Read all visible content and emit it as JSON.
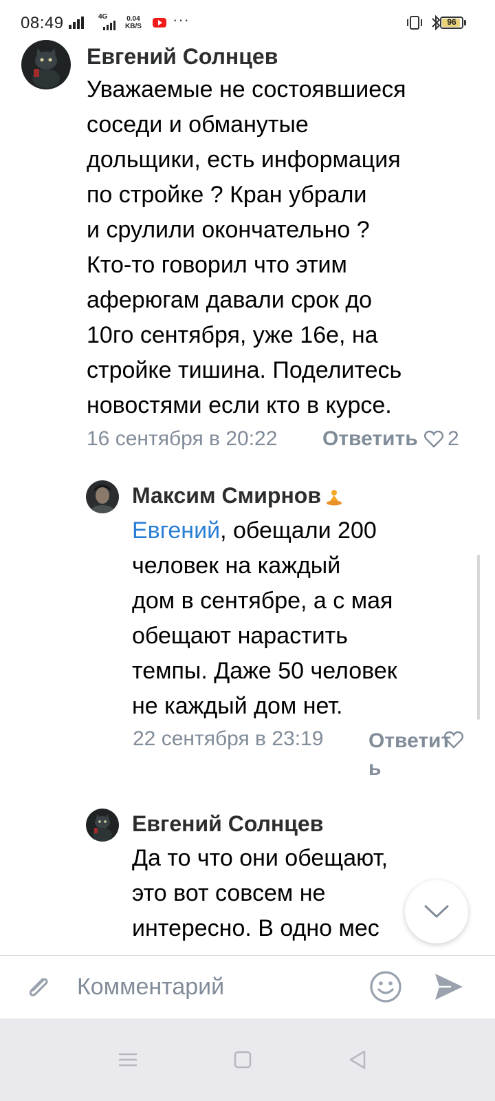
{
  "status_bar": {
    "time": "08:49",
    "network": "4G",
    "speed_value": "0.04",
    "speed_unit": "KB/S",
    "more": "···",
    "battery": "96",
    "icons": [
      "signal-icon",
      "youtube-icon",
      "vibrate-icon",
      "bluetooth-icon",
      "battery-icon"
    ]
  },
  "comments": [
    {
      "author": "Евгений Солнцев",
      "text_lines": [
        "Уважаемые не состоявшиеся",
        "соседи и обманутые",
        "дольщики, есть информация",
        "по стройке ? Кран убрали",
        "и срулили окончательно ?",
        "Кто-то говорил что этим",
        "аферюгам давали срок до",
        "10го сентября, уже 16е, на",
        "стройке тишина. Поделитесь",
        "новостями если кто в курсе."
      ],
      "date": "16 сентября в 20:22",
      "reply_label": "Ответить",
      "likes": "2"
    },
    {
      "author": "Максим Смирнов",
      "mention": "Евгений",
      "text_first_rest": ", обещали 200",
      "text_lines": [
        "человек на каждый",
        "дом в сентябре, а с мая",
        "обещают нарастить",
        "темпы. Даже 50 человек",
        "не каждый дом нет."
      ],
      "date": "22 сентября в 23:19",
      "reply_label_1": "Ответит",
      "reply_label_2": "ь"
    },
    {
      "author": "Евгений Солнцев",
      "text_lines": [
        "Да то что они обещают,",
        "это вот совсем не",
        "интересно. В одно мес"
      ]
    }
  ],
  "composer": {
    "placeholder": "Комментарий"
  },
  "colors": {
    "accent": "#2a7fd4",
    "secondary_text": "#818c99",
    "nav_bg": "#e9e9ee"
  }
}
